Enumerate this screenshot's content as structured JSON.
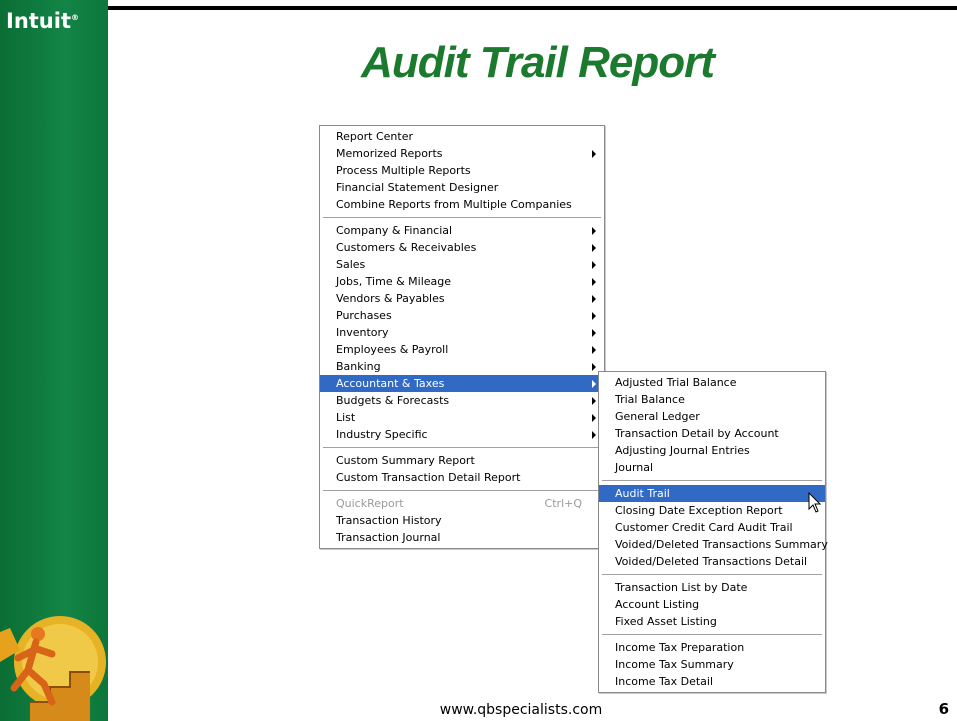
{
  "brand": {
    "logo_text": "Intuit"
  },
  "slide": {
    "title": "Audit Trail Report",
    "footer_url": "www.qbspecialists.com",
    "page_number": "6"
  },
  "main_menu": {
    "groups": [
      [
        {
          "label": "Report Center",
          "submenu": false
        },
        {
          "label": "Memorized Reports",
          "submenu": true
        },
        {
          "label": "Process Multiple Reports",
          "submenu": false
        },
        {
          "label": "Financial Statement Designer",
          "submenu": false
        },
        {
          "label": "Combine Reports from Multiple Companies",
          "submenu": false
        }
      ],
      [
        {
          "label": "Company & Financial",
          "submenu": true
        },
        {
          "label": "Customers & Receivables",
          "submenu": true
        },
        {
          "label": "Sales",
          "submenu": true
        },
        {
          "label": "Jobs, Time & Mileage",
          "submenu": true
        },
        {
          "label": "Vendors & Payables",
          "submenu": true
        },
        {
          "label": "Purchases",
          "submenu": true
        },
        {
          "label": "Inventory",
          "submenu": true
        },
        {
          "label": "Employees & Payroll",
          "submenu": true
        },
        {
          "label": "Banking",
          "submenu": true
        },
        {
          "label": "Accountant & Taxes",
          "submenu": true,
          "highlighted": true
        },
        {
          "label": "Budgets & Forecasts",
          "submenu": true
        },
        {
          "label": "List",
          "submenu": true
        },
        {
          "label": "Industry Specific",
          "submenu": true
        }
      ],
      [
        {
          "label": "Custom Summary Report",
          "submenu": false
        },
        {
          "label": "Custom Transaction Detail Report",
          "submenu": false
        }
      ],
      [
        {
          "label": "QuickReport",
          "submenu": false,
          "disabled": true,
          "shortcut": "Ctrl+Q"
        },
        {
          "label": "Transaction History",
          "submenu": false
        },
        {
          "label": "Transaction Journal",
          "submenu": false
        }
      ]
    ]
  },
  "sub_menu": {
    "groups": [
      [
        {
          "label": "Adjusted Trial Balance"
        },
        {
          "label": "Trial Balance"
        },
        {
          "label": "General Ledger"
        },
        {
          "label": "Transaction Detail by Account"
        },
        {
          "label": "Adjusting Journal Entries"
        },
        {
          "label": "Journal"
        }
      ],
      [
        {
          "label": "Audit Trail",
          "highlighted": true
        },
        {
          "label": "Closing Date Exception Report"
        },
        {
          "label": "Customer Credit Card Audit Trail"
        },
        {
          "label": "Voided/Deleted Transactions Summary"
        },
        {
          "label": "Voided/Deleted Transactions Detail"
        }
      ],
      [
        {
          "label": "Transaction List by Date"
        },
        {
          "label": "Account Listing"
        },
        {
          "label": "Fixed Asset Listing"
        }
      ],
      [
        {
          "label": "Income Tax Preparation"
        },
        {
          "label": "Income Tax Summary"
        },
        {
          "label": "Income Tax Detail"
        }
      ]
    ]
  },
  "colors": {
    "sidebar": "#0e7a3c",
    "title": "#1c7a2f",
    "highlight": "#316ac5"
  }
}
